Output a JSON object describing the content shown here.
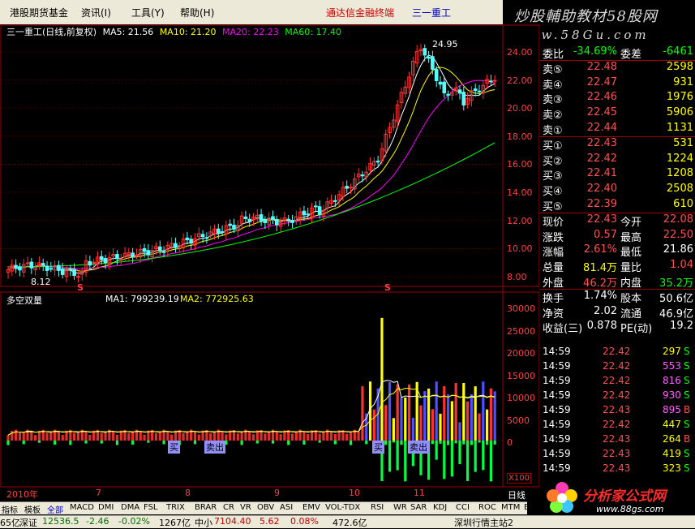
{
  "menu": {
    "items": [
      "港股期货基金",
      "资讯(I)",
      "工具(Y)",
      "帮助(H)"
    ],
    "title": "通达信金融终端",
    "stock": "三一重工"
  },
  "banner": {
    "line1": "炒股輔助教材58股网",
    "line2": "www.58Gu.com"
  },
  "main_chart": {
    "stock_label": "三一重工(日线,前复权)",
    "ma_labels": [
      {
        "text": "MA5: 21.56",
        "color": "#ffffff"
      },
      {
        "text": "MA10: 21.20",
        "color": "#ffff00"
      },
      {
        "text": "MA20: 22.23",
        "color": "#ff00ff"
      },
      {
        "text": "MA60: 17.40",
        "color": "#00ff00"
      }
    ],
    "high_label": "24.95",
    "low_label": "8.12",
    "s_marker": "S",
    "y_ticks": [
      "24.00",
      "22.00",
      "20.00",
      "18.00",
      "16.00",
      "14.00",
      "12.00",
      "10.00",
      "8.00"
    ]
  },
  "sub_chart": {
    "title": "多空双量",
    "ma1": "MA1: 799239.19",
    "ma2": "MA2: 772925.63",
    "y_ticks": [
      "30000",
      "25000",
      "20000",
      "15000",
      "10000",
      "5000",
      "0"
    ],
    "unit": "X100",
    "buy_label": "买",
    "sell_label": "卖出"
  },
  "x_axis": {
    "labels": [
      "2010年",
      "7",
      "8",
      "9",
      "10",
      "11"
    ]
  },
  "period": "日线",
  "chart_data": {
    "type": "candlestick",
    "title": "三一重工(日线,前复权)",
    "y_range": [
      8.0,
      25.0
    ],
    "high": 24.95,
    "low": 8.12,
    "series": [
      {
        "name": "MA5",
        "last": 21.56
      },
      {
        "name": "MA10",
        "last": 21.2
      },
      {
        "name": "MA20",
        "last": 22.23
      },
      {
        "name": "MA60",
        "last": 17.4
      }
    ]
  },
  "quote": {
    "rows": [
      {
        "k1": "委比",
        "v1": "-34.69%",
        "k2": "委差",
        "v2": "-6461",
        "c1": "#00ff00",
        "c2": "#00ff00"
      },
      {
        "k1": "卖⑤",
        "v1": "22.48",
        "k2": "",
        "v2": "2598",
        "c1": "#ff5050",
        "c2": "#ffff00"
      },
      {
        "k1": "卖④",
        "v1": "22.47",
        "k2": "",
        "v2": "931",
        "c1": "#ff5050",
        "c2": "#ffff00"
      },
      {
        "k1": "卖③",
        "v1": "22.46",
        "k2": "",
        "v2": "1976",
        "c1": "#ff5050",
        "c2": "#ffff00"
      },
      {
        "k1": "卖②",
        "v1": "22.45",
        "k2": "",
        "v2": "5906",
        "c1": "#ff5050",
        "c2": "#ffff00"
      },
      {
        "k1": "卖①",
        "v1": "22.44",
        "k2": "",
        "v2": "1131",
        "c1": "#ff5050",
        "c2": "#ffff00"
      },
      {
        "k1": "买①",
        "v1": "22.43",
        "k2": "",
        "v2": "531",
        "c1": "#ff5050",
        "c2": "#ffff00"
      },
      {
        "k1": "买②",
        "v1": "22.42",
        "k2": "",
        "v2": "1224",
        "c1": "#ff5050",
        "c2": "#ffff00"
      },
      {
        "k1": "买③",
        "v1": "22.41",
        "k2": "",
        "v2": "1208",
        "c1": "#ff5050",
        "c2": "#ffff00"
      },
      {
        "k1": "买④",
        "v1": "22.40",
        "k2": "",
        "v2": "2508",
        "c1": "#ff5050",
        "c2": "#ffff00"
      },
      {
        "k1": "买⑤",
        "v1": "22.39",
        "k2": "",
        "v2": "610",
        "c1": "#ff5050",
        "c2": "#ffff00"
      },
      {
        "k1": "现价",
        "v1": "22.43",
        "k2": "今开",
        "v2": "22.08",
        "c1": "#ff5050",
        "c2": "#ff5050"
      },
      {
        "k1": "涨跌",
        "v1": "0.57",
        "k2": "最高",
        "v2": "22.50",
        "c1": "#ff5050",
        "c2": "#ff5050"
      },
      {
        "k1": "涨幅",
        "v1": "2.61%",
        "k2": "最低",
        "v2": "21.86",
        "c1": "#ff5050",
        "c2": "#ffffff"
      },
      {
        "k1": "总量",
        "v1": "81.4万",
        "k2": "量比",
        "v2": "1.04",
        "c1": "#ffff00",
        "c2": "#ff5050"
      },
      {
        "k1": "外盘",
        "v1": "46.2万",
        "k2": "内盘",
        "v2": "35.2万",
        "c1": "#ff5050",
        "c2": "#00ff00"
      },
      {
        "k1": "换手",
        "v1": "1.74%",
        "k2": "股本",
        "v2": "50.6亿",
        "c1": "#ffffff",
        "c2": "#ffffff"
      },
      {
        "k1": "净资",
        "v1": "2.02",
        "k2": "流通",
        "v2": "46.9亿",
        "c1": "#ffffff",
        "c2": "#ffffff"
      },
      {
        "k1": "收益(三)",
        "v1": "0.878",
        "k2": "PE(动)",
        "v2": "19.2",
        "c1": "#ffffff",
        "c2": "#ffffff"
      }
    ]
  },
  "ticks": [
    {
      "time": "14:59",
      "price": "22.42",
      "vol": "297",
      "side": "S",
      "pc": "#ff5050",
      "vc": "#ffff00",
      "sc": "#00ff00"
    },
    {
      "time": "14:59",
      "price": "22.42",
      "vol": "553",
      "side": "S",
      "pc": "#ff5050",
      "vc": "#ff60ff",
      "sc": "#00ff00"
    },
    {
      "time": "14:59",
      "price": "22.42",
      "vol": "816",
      "side": "S",
      "pc": "#ff5050",
      "vc": "#ff60ff",
      "sc": "#00ff00"
    },
    {
      "time": "14:59",
      "price": "22.42",
      "vol": "930",
      "side": "S",
      "pc": "#ff5050",
      "vc": "#ff60ff",
      "sc": "#00ff00"
    },
    {
      "time": "14:59",
      "price": "22.43",
      "vol": "895",
      "side": "B",
      "pc": "#ff5050",
      "vc": "#ff60ff",
      "sc": "#ff5050"
    },
    {
      "time": "14:59",
      "price": "22.42",
      "vol": "447",
      "side": "S",
      "pc": "#ff5050",
      "vc": "#ffff00",
      "sc": "#00ff00"
    },
    {
      "time": "14:59",
      "price": "22.43",
      "vol": "264",
      "side": "B",
      "pc": "#ff5050",
      "vc": "#ffff00",
      "sc": "#ff5050"
    },
    {
      "time": "14:59",
      "price": "22.43",
      "vol": "419",
      "side": "S",
      "pc": "#ff5050",
      "vc": "#ffff00",
      "sc": "#00ff00"
    },
    {
      "time": "14:59",
      "price": "22.43",
      "vol": "323",
      "side": "S",
      "pc": "#ff5050",
      "vc": "#ffff00",
      "sc": "#00ff00"
    }
  ],
  "indicator_tabs": [
    "指标",
    "模板",
    "全部",
    "MACD",
    "DMI",
    "DMA",
    "FSL",
    "TRIX",
    "BRAR",
    "CR",
    "VR",
    "OBV",
    "ASI",
    "EMV",
    "VOL-TDX",
    "RSI",
    "WR",
    "SAR",
    "KDJ",
    "CCI",
    "ROC",
    "MTM",
    "BOLL"
  ],
  "status": {
    "left_fragment": "65亿",
    "index_name": "深证",
    "index_value": "12536.5",
    "change": "-2.46",
    "pct": "-0.02%",
    "amount": "1267亿",
    "board_name": "中小",
    "board_value": "7104.40",
    "board_change": "5.62",
    "board_pct": "0.08%",
    "board_amount": "472.6亿",
    "server": "深圳行情主站2"
  },
  "logo": {
    "name": "分析家公式网",
    "url": "www.88gs.com"
  }
}
